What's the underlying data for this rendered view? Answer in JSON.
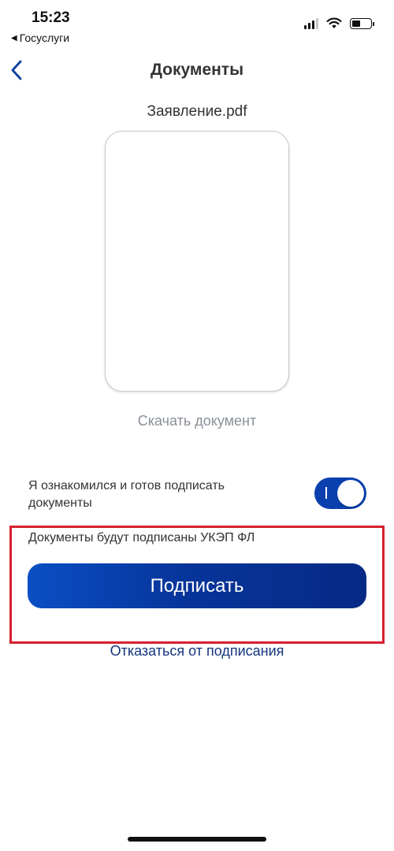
{
  "status_bar": {
    "time": "15:23",
    "back_app_arrow": "◀",
    "back_app_label": "Госуслуги",
    "icons": [
      "cellular-signal-icon",
      "wifi-icon",
      "battery-icon"
    ]
  },
  "nav": {
    "back_icon": "chevron-left-icon",
    "title": "Документы"
  },
  "document": {
    "file_name": "Заявление.pdf",
    "download_label": "Скачать документ"
  },
  "agreement": {
    "text": "Я ознакомился и готов подписать документы",
    "toggle_on": true
  },
  "signing": {
    "note": "Документы будут подписаны УКЭП ФЛ",
    "sign_button_label": "Подписать",
    "decline_label": "Отказаться от подписания"
  },
  "colors": {
    "accent": "#0a3fae",
    "link_dark": "#14357e",
    "highlight_border": "#d6202f",
    "muted_text": "#8a8f98"
  }
}
